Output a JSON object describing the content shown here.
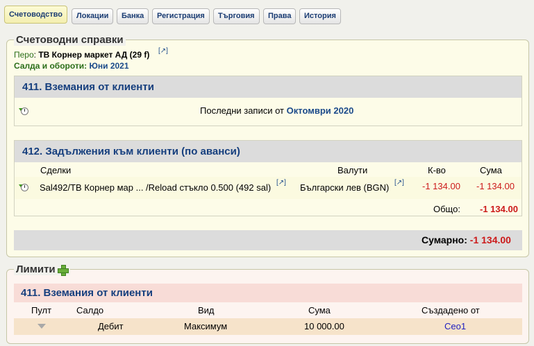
{
  "tabs": [
    "Счетоводство",
    "Локации",
    "Банка",
    "Регистрация",
    "Търговия",
    "Права",
    "История"
  ],
  "reports": {
    "legend": "Счетоводни справки",
    "pero_label": "Перо",
    "pero_value": "ТВ Корнер маркет АД (29 f)",
    "link_glyph": "[↗]",
    "balances_label": "Салда и обороти:",
    "balances_value": "Юни 2021",
    "sec411": {
      "title": "411. Вземания от клиенти",
      "last_text": "Последни записи от",
      "last_link": "Октомври 2020"
    },
    "sec412": {
      "title": "412. Задължения към клиенти (по аванси)",
      "headers": {
        "deals": "Сделки",
        "currency": "Валути",
        "qty": "К-во",
        "amount": "Сума"
      },
      "row": {
        "deal": "Sal492/ТВ Корнер мар ... /Reload стъкло 0.500 (492 sal)",
        "currency": "Български лев (BGN)",
        "qty": "-1 134.00",
        "amount": "-1 134.00"
      },
      "total_label": "Общо:",
      "total_value": "-1 134.00"
    },
    "summary_label": "Сумарно:",
    "summary_value": "-1 134.00"
  },
  "limits": {
    "legend": "Лимити",
    "sec_title": "411. Вземания от клиенти",
    "headers": {
      "console": "Пулт",
      "balance": "Салдо",
      "kind": "Вид",
      "amount": "Сума",
      "created": "Създадено от"
    },
    "row": {
      "balance": "Дебит",
      "kind": "Максимум",
      "amount": "10 000.00",
      "created": "Ceo1"
    }
  }
}
